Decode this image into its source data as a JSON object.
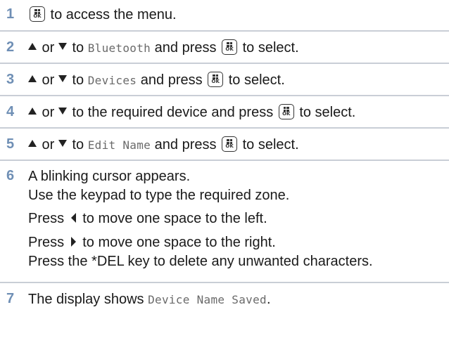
{
  "icons": {
    "ok_button": "menu-ok-button-icon",
    "up": "up-arrow-icon",
    "down": "down-arrow-icon",
    "left": "left-arrow-icon",
    "right": "right-arrow-icon"
  },
  "ok_label": "OK",
  "colors": {
    "step_number": "#6f8fb5",
    "divider": "#c9ced6",
    "mono_text": "#6a6a6a"
  },
  "steps": [
    {
      "number": "1",
      "text_a": " to access the menu."
    },
    {
      "number": "2",
      "or": " or ",
      "to": " to ",
      "menu_item": "Bluetooth",
      "text_b": " and press ",
      "text_c": " to select."
    },
    {
      "number": "3",
      "or": " or ",
      "to": " to ",
      "menu_item": "Devices",
      "text_b": " and press ",
      "text_c": " to select."
    },
    {
      "number": "4",
      "or": " or ",
      "text_a": " to the required device and press ",
      "text_c": " to select."
    },
    {
      "number": "5",
      "or": " or ",
      "to": " to ",
      "menu_item": "Edit Name",
      "text_b": " and press ",
      "text_c": " to select."
    },
    {
      "number": "6",
      "line1": "A blinking cursor appears.",
      "line2": "Use the keypad to type the required zone.",
      "line3_a": "Press ",
      "line3_b": " to move one space to the left.",
      "line4_a": "Press ",
      "line4_b": " to move one space to the right.",
      "line5": "Press the *DEL key to delete any unwanted characters."
    },
    {
      "number": "7",
      "text_a": "The display shows ",
      "display_text": "Device Name Saved",
      "text_end": "."
    }
  ]
}
